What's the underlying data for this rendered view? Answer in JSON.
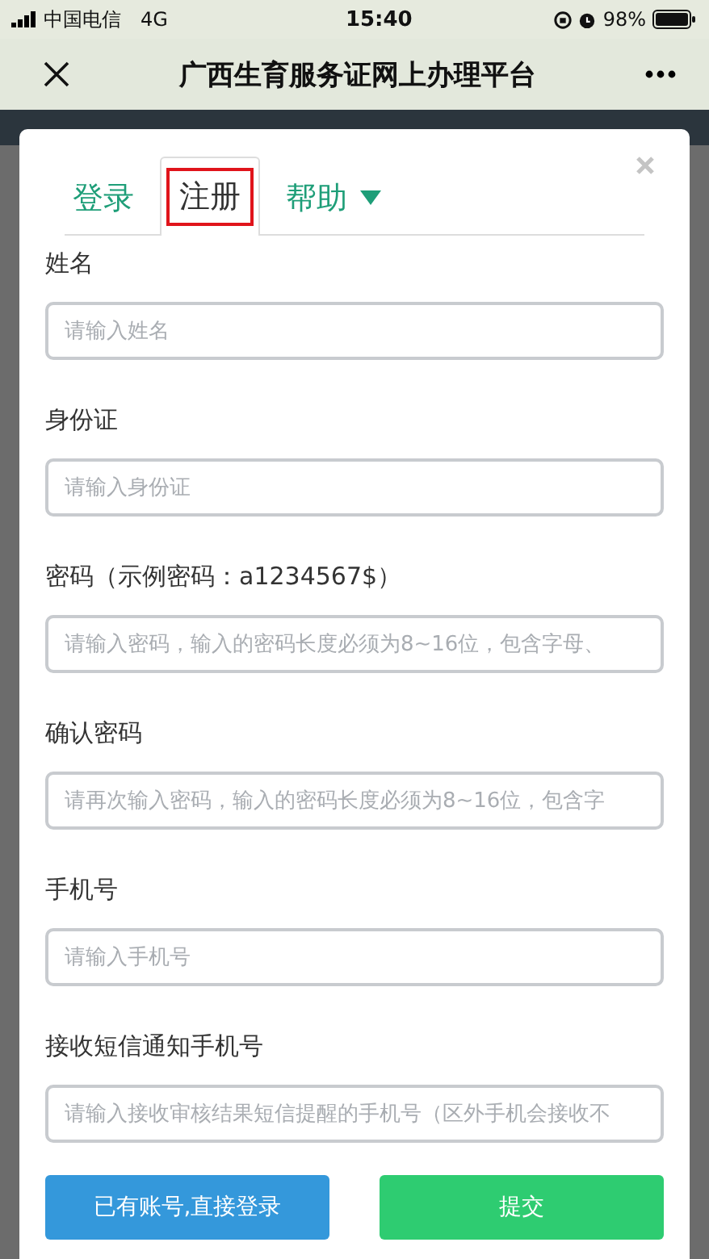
{
  "status_bar": {
    "carrier": "中国电信",
    "network": "4G",
    "time": "15:40",
    "battery": "98%"
  },
  "nav": {
    "title": "广西生育服务证网上办理平台"
  },
  "tabs": [
    {
      "label": "登录",
      "selected": false,
      "dropdown": false
    },
    {
      "label": "注册",
      "selected": true,
      "dropdown": false
    },
    {
      "label": "帮助",
      "selected": false,
      "dropdown": true
    }
  ],
  "fields": [
    {
      "label": "姓名",
      "placeholder": "请输入姓名"
    },
    {
      "label": "身份证",
      "placeholder": "请输入身份证"
    },
    {
      "label": "密码（示例密码：a1234567$）",
      "placeholder": "请输入密码，输入的密码长度必须为8~16位，包含字母、"
    },
    {
      "label": "确认密码",
      "placeholder": "请再次输入密码，输入的密码长度必须为8~16位，包含字"
    },
    {
      "label": "手机号",
      "placeholder": "请输入手机号"
    },
    {
      "label": "接收短信通知手机号",
      "placeholder": "请输入接收审核结果短信提醒的手机号（区外手机会接收不"
    }
  ],
  "buttons": [
    {
      "label": "已有账号,直接登录",
      "kind": "secondary"
    },
    {
      "label": "提交",
      "kind": "primary"
    }
  ]
}
